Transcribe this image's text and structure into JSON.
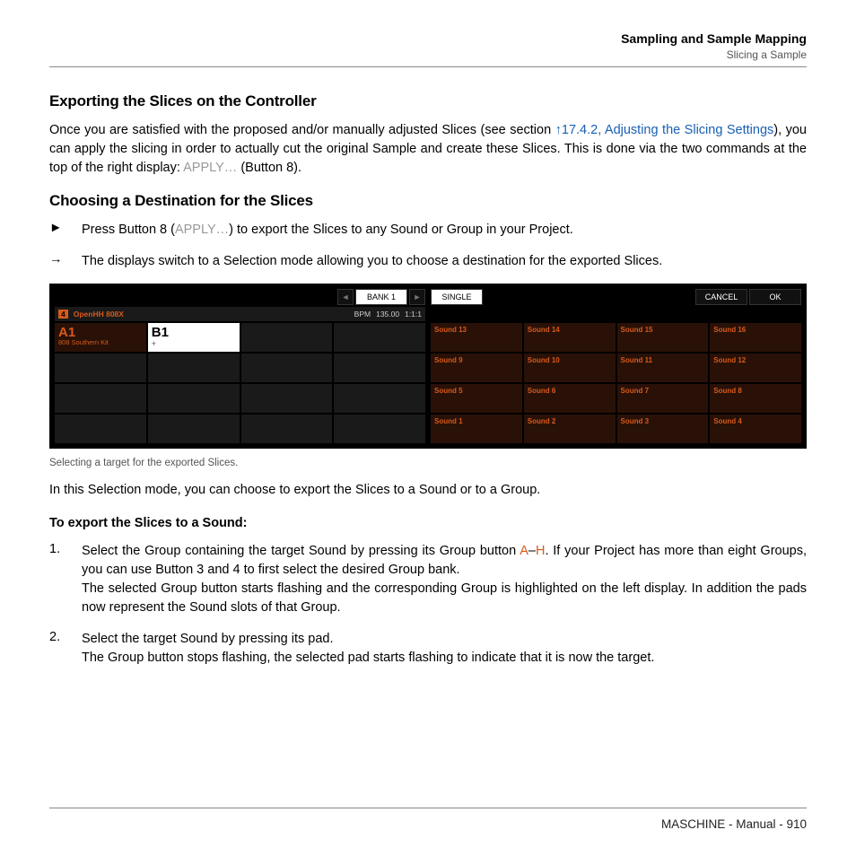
{
  "header": {
    "title": "Sampling and Sample Mapping",
    "subtitle": "Slicing a Sample"
  },
  "section1": {
    "title": "Exporting the Slices on the Controller",
    "p1a": "Once you are satisfied with the proposed and/or manually adjusted Slices (see section ",
    "p1link": "↑17.4.2, Adjusting the Slicing Settings",
    "p1b": "), you can apply the slicing in order to actually cut the original Sample and create these Slices. This is done via the two commands at the top of the right display: ",
    "p1apply": "APPLY…",
    "p1c": " (Button 8)."
  },
  "section2": {
    "title": "Choosing a Destination for the Slices",
    "bullet_marker": "►",
    "bullet_a": "Press Button 8 (",
    "bullet_apply": "APPLY…",
    "bullet_b": ") to export the Slices to any Sound or Group in your Project.",
    "arrow_marker": "→",
    "arrow_text": "The displays switch to a Selection mode allowing you to choose a destination for the exported Slices."
  },
  "device": {
    "bank_label": "BANK 1",
    "left_arrow": "◄",
    "right_arrow": "►",
    "info_badge": "4",
    "info_name": "OpenHH 808X",
    "bpm_label": "BPM",
    "bpm_value": "135.00",
    "position": "1:1:1",
    "group_a_big": "A1",
    "group_a_sub": "808 Southern Kit",
    "group_b_big": "B1",
    "group_b_sub": "+",
    "btn_single": "SINGLE",
    "btn_cancel": "CANCEL",
    "btn_ok": "OK",
    "sounds": [
      [
        "Sound 13",
        "Sound 14",
        "Sound 15",
        "Sound 16"
      ],
      [
        "Sound 9",
        "Sound 10",
        "Sound 11",
        "Sound 12"
      ],
      [
        "Sound 5",
        "Sound 6",
        "Sound 7",
        "Sound 8"
      ],
      [
        "Sound 1",
        "Sound 2",
        "Sound 3",
        "Sound 4"
      ]
    ]
  },
  "caption": "Selecting a target for the exported Slices.",
  "after_caption": "In this Selection mode, you can choose to export the Slices to a Sound or to a Group.",
  "export_title": "To export the Slices to a Sound:",
  "step1": {
    "num": "1.",
    "a": "Select the Group containing the target Sound by pressing its Group button ",
    "ah": "A",
    "dash": "–",
    "hh": "H",
    "b": ". If your Project has more than eight Groups, you can use Button 3 and 4 to first select the desired Group bank.",
    "c": "The selected Group button starts flashing and the corresponding Group is highlighted on the left display. In addition the pads now represent the Sound slots of that Group."
  },
  "step2": {
    "num": "2.",
    "a": "Select the target Sound by pressing its pad.",
    "b": "The Group button stops flashing, the selected pad starts flashing to indicate that it is now the target."
  },
  "footer": "MASCHINE - Manual - 910"
}
